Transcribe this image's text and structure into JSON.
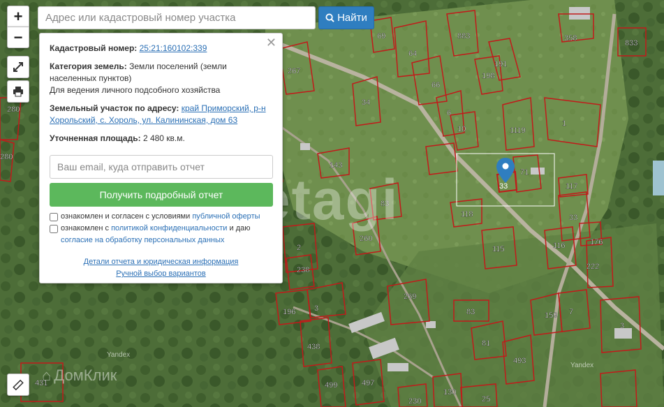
{
  "search": {
    "placeholder": "Адрес или кадастровый номер участка",
    "button_label": "Найти"
  },
  "controls": {
    "zoom_in": "+",
    "zoom_out": "−"
  },
  "panel": {
    "cadastral_label": "Кадастровый номер:",
    "cadastral_value": "25:21:160102:339",
    "category_label": "Категория земель:",
    "category_value": "Земли поселений (земли населенных пунктов)",
    "category_use": "Для ведения личного подсобного хозяйства",
    "address_label": "Земельный участок по адресу:",
    "address_value": "край Приморский, р-н Хорольский, с. Хороль, ул. Калининская, дом 63",
    "area_label": "Уточненная площадь:",
    "area_value": "2 480 кв.м.",
    "email_placeholder": "Ваш email, куда отправить отчет",
    "report_button": "Получить подробный отчет",
    "consent1_text": "ознакомлен и согласен с условиями",
    "consent1_link": "публичной оферты",
    "consent2_text": "ознакомлен с",
    "consent2_link": "политикой конфиденциальности",
    "consent2_mid": "и даю",
    "consent2_link2": "согласие на обработку персональных данных",
    "details_link": "Детали отчета и юридическая информация",
    "manual_link": "Ручной выбор вариантов"
  },
  "watermarks": {
    "etagi": "etagi",
    "domclick": "ДомКлик",
    "yandex1": "Yandex",
    "yandex2": "Yandex"
  },
  "parcel_labels": [
    "280",
    "280",
    "267",
    "34",
    "66",
    "69",
    "64",
    "883",
    "191",
    "198",
    "196",
    "6",
    "10",
    "1119",
    "1",
    "358",
    "833",
    "33",
    "117",
    "71",
    "143",
    "83",
    "118",
    "260",
    "115",
    "2",
    "238",
    "33",
    "116",
    "16",
    "176",
    "222",
    "3",
    "196",
    "269",
    "83",
    "81",
    "159",
    "7",
    "1",
    "438",
    "493",
    "431",
    "499",
    "497",
    "230",
    "130",
    "25",
    "3",
    "3"
  ],
  "marker_label": "33"
}
